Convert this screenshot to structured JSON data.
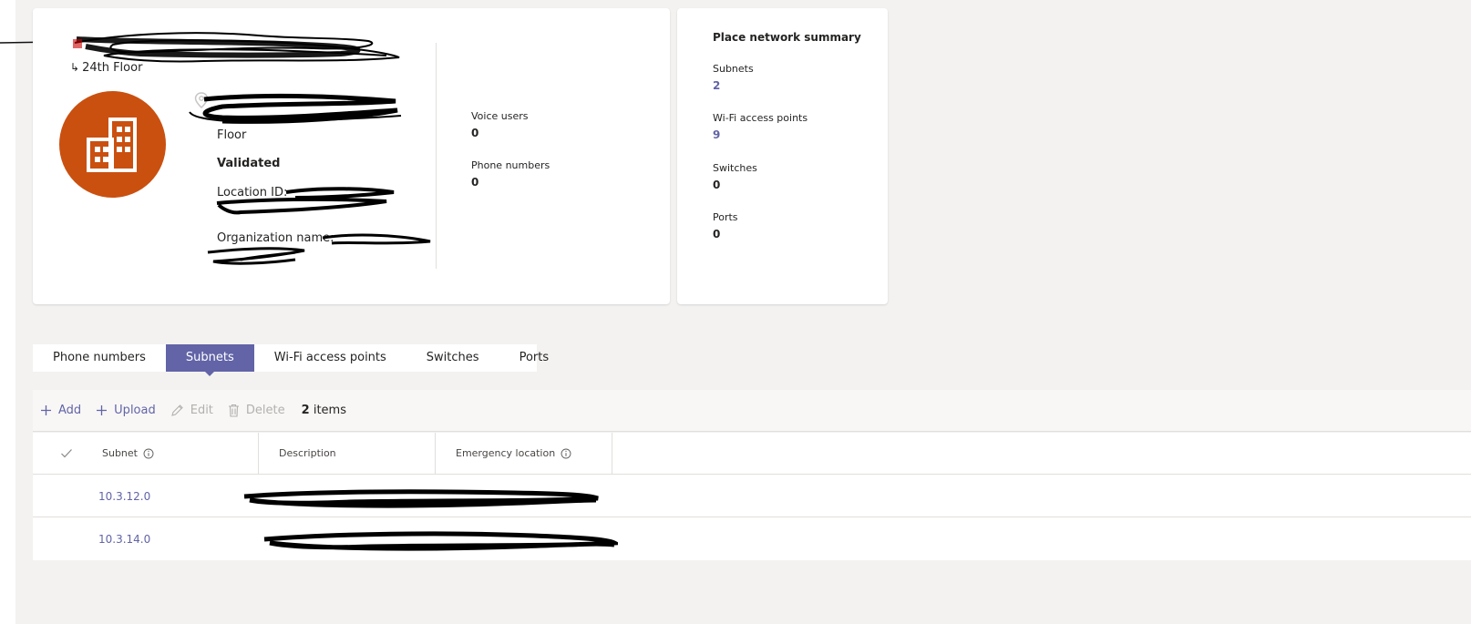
{
  "place": {
    "parent_label": "24th Floor",
    "address_floor": "Floor",
    "validation_status": "Validated",
    "location_id_label": "Location ID:",
    "organization_name_label": "Organization name:"
  },
  "stats": {
    "voice_users": {
      "label": "Voice users",
      "value": "0"
    },
    "phone_numbers": {
      "label": "Phone numbers",
      "value": "0"
    }
  },
  "summary": {
    "title": "Place network summary",
    "items": [
      {
        "label": "Subnets",
        "value": "2",
        "link": true
      },
      {
        "label": "Wi-Fi access points",
        "value": "9",
        "link": true
      },
      {
        "label": "Switches",
        "value": "0",
        "link": false
      },
      {
        "label": "Ports",
        "value": "0",
        "link": false
      }
    ]
  },
  "tabs": [
    {
      "label": "Phone numbers",
      "active": false
    },
    {
      "label": "Subnets",
      "active": true
    },
    {
      "label": "Wi-Fi access points",
      "active": false
    },
    {
      "label": "Switches",
      "active": false
    },
    {
      "label": "Ports",
      "active": false
    }
  ],
  "toolbar": {
    "add": "Add",
    "upload": "Upload",
    "edit": "Edit",
    "delete": "Delete",
    "count_number": "2",
    "count_label": "items"
  },
  "table": {
    "columns": [
      "Subnet",
      "Description",
      "Emergency location"
    ],
    "rows": [
      {
        "subnet": "10.3.12.0"
      },
      {
        "subnet": "10.3.14.0"
      }
    ]
  },
  "colors": {
    "accent": "#6264a7",
    "avatar": "#ca5010"
  },
  "icons": [
    "building-icon",
    "location-pin-icon",
    "plus-icon",
    "pencil-icon",
    "trash-icon",
    "check-icon",
    "info-icon"
  ]
}
